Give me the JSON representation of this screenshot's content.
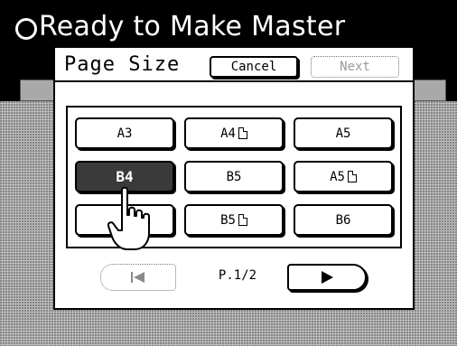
{
  "status": {
    "icon": "status-ring-icon",
    "text": "Ready to Make Master"
  },
  "dialog": {
    "title": "Page Size",
    "cancel_label": "Cancel",
    "next_label": "Next",
    "next_enabled": false
  },
  "sizes": [
    {
      "label": "A3",
      "orientation_icon": false,
      "selected": false
    },
    {
      "label": "A4",
      "orientation_icon": true,
      "selected": false
    },
    {
      "label": "A5",
      "orientation_icon": false,
      "selected": false
    },
    {
      "label": "B4",
      "orientation_icon": false,
      "selected": true
    },
    {
      "label": "B5",
      "orientation_icon": false,
      "selected": false
    },
    {
      "label": "A5",
      "orientation_icon": true,
      "selected": false
    },
    {
      "label": "",
      "orientation_icon": false,
      "selected": false
    },
    {
      "label": "B5",
      "orientation_icon": true,
      "selected": false
    },
    {
      "label": "B6",
      "orientation_icon": false,
      "selected": false
    }
  ],
  "pager": {
    "prev_icon": "arrow-left-icon",
    "indicator": "P.1/2",
    "next_icon": "arrow-right-icon",
    "prev_enabled": false
  },
  "cursor_icon": "pointing-hand-icon",
  "colors": {
    "title_bar": "#000000",
    "selected_button": "#3a3a3a",
    "background_dither": "#bdbdbd"
  }
}
